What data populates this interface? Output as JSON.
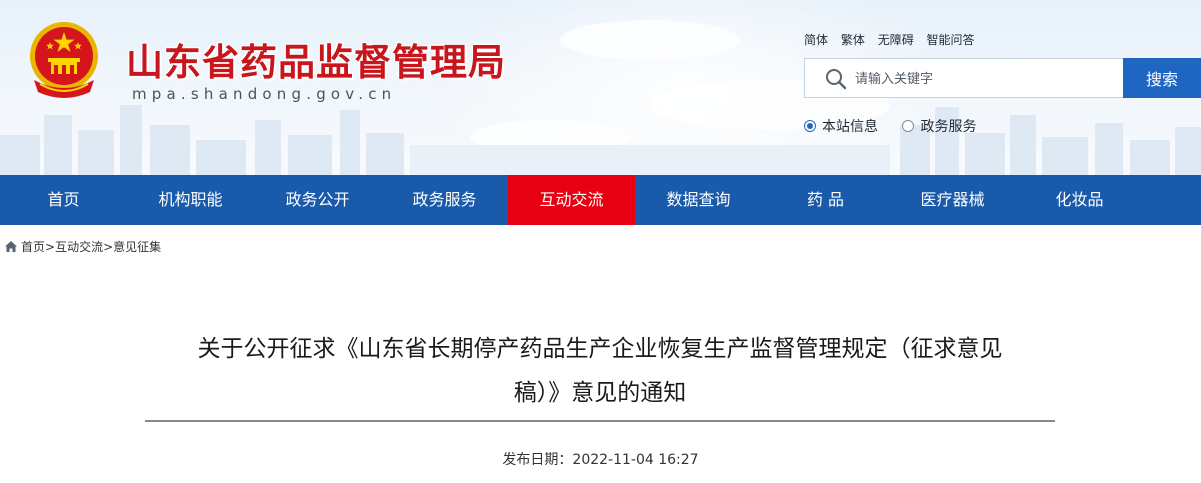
{
  "site": {
    "title": "山东省药品监督管理局",
    "domain": "mpa.shandong.gov.cn"
  },
  "top_links": [
    "简体",
    "繁体",
    "无障碍",
    "智能问答"
  ],
  "search": {
    "placeholder": "请输入关键字",
    "button_label": "搜索",
    "scopes": [
      {
        "label": "本站信息",
        "selected": true
      },
      {
        "label": "政务服务",
        "selected": false
      }
    ]
  },
  "nav": {
    "items": [
      "首页",
      "机构职能",
      "政务公开",
      "政务服务",
      "互动交流",
      "数据查询",
      "药 品",
      "医疗器械",
      "化妆品"
    ],
    "active_index": 4
  },
  "breadcrumb": {
    "items": [
      "首页",
      "互动交流",
      "意见征集"
    ],
    "separator": ">"
  },
  "article": {
    "title_line1": "关于公开征求《山东省长期停产药品生产企业恢复生产监督管理规定（征求意见",
    "title_line2": "稿）》意见的通知",
    "publish_date": "发布日期：2022-11-04 16:27"
  },
  "colors": {
    "nav_bg": "#1a5aaa",
    "nav_active": "#e60012",
    "title_red": "#c8161d",
    "search_button": "#1f66c2"
  }
}
